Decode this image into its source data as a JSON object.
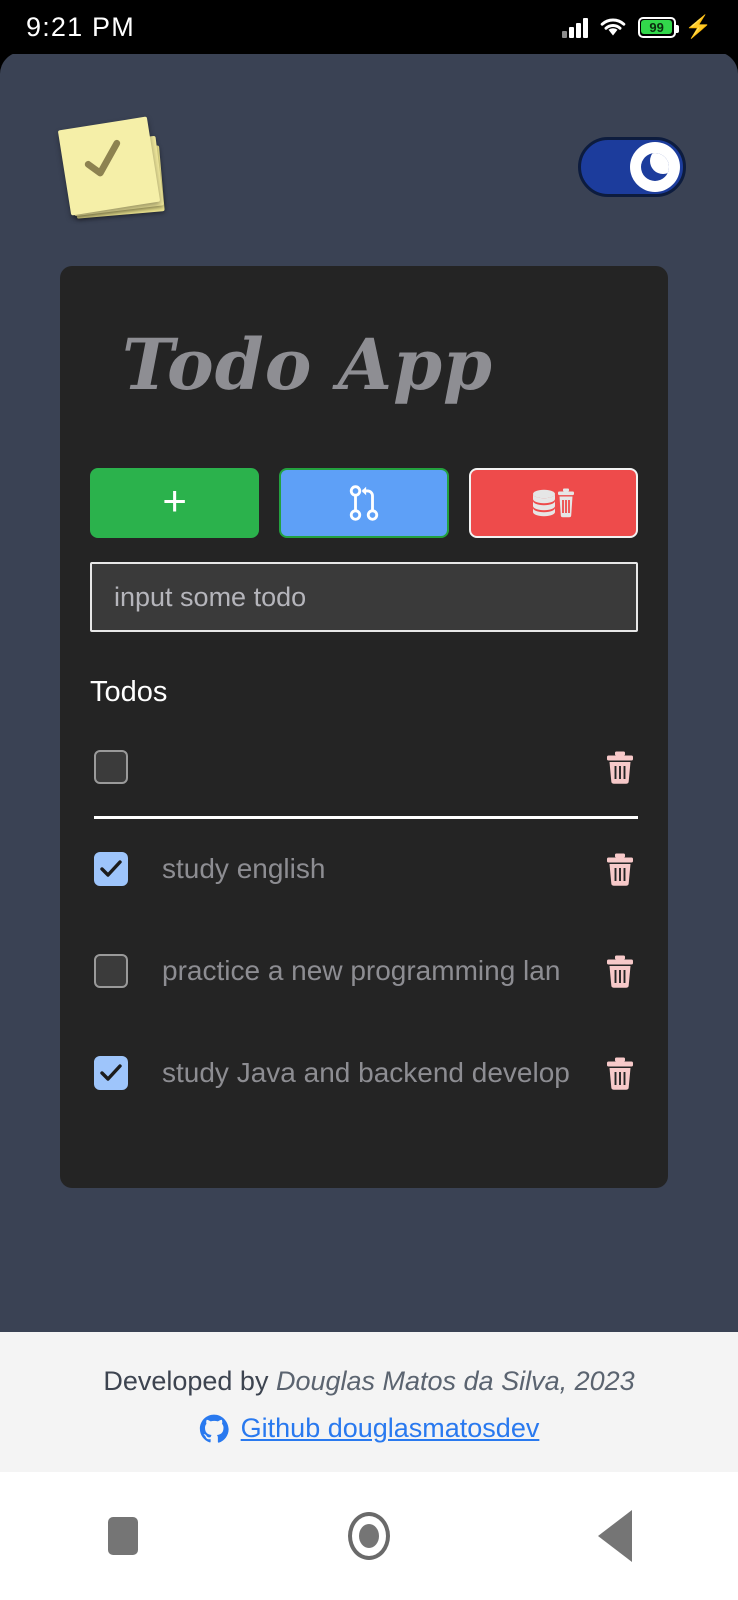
{
  "status_bar": {
    "time": "9:21 PM",
    "battery_level": "99",
    "icons": [
      "signal-icon",
      "wifi-icon",
      "battery-icon",
      "charging-bolt-icon"
    ]
  },
  "header": {
    "logo_name": "sticky-note-check-logo",
    "theme_toggle": {
      "state": "dark",
      "icon": "moon-icon"
    }
  },
  "card": {
    "title": "Todo App",
    "buttons": [
      {
        "name": "add-todo-button",
        "icon": "plus-icon",
        "label": "+",
        "color": "#2bb24c"
      },
      {
        "name": "sync-button",
        "icon": "git-pull-request-icon",
        "label": "",
        "color": "#5ea0f7"
      },
      {
        "name": "clear-database-button",
        "icon": "database-trash-icon",
        "label": "",
        "color": "#ee4b4b"
      }
    ],
    "input": {
      "value": "",
      "placeholder": "input some todo"
    },
    "list_label": "Todos",
    "todos": [
      {
        "text": "",
        "checked": false
      },
      {
        "text": "study english",
        "checked": true
      },
      {
        "text": "practice a new programming lan",
        "checked": false
      },
      {
        "text": "study Java and backend develop",
        "checked": true
      }
    ]
  },
  "footer": {
    "developed_by": "Developed by ",
    "author": "Douglas Matos da Silva, 2023",
    "github_icon": "github-icon",
    "github_link": "Github douglasmatosdev"
  },
  "navbar": {
    "recents": "recents-square-icon",
    "home": "home-circle-icon",
    "back": "back-triangle-icon"
  }
}
